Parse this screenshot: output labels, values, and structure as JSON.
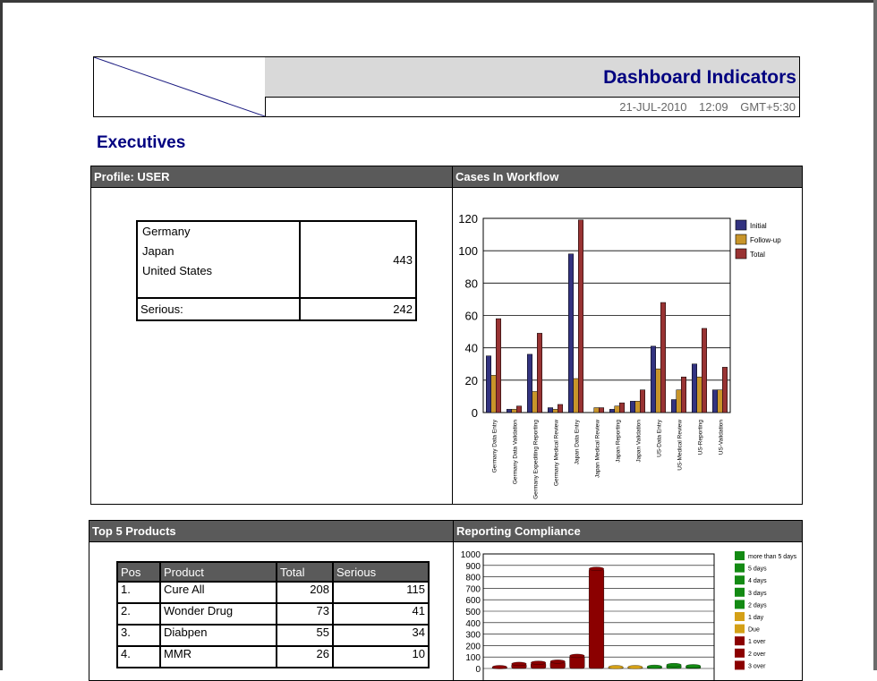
{
  "header": {
    "title": "Dashboard Indicators",
    "date": "21-JUL-2010",
    "time": "12:09",
    "timezone": "GMT+5:30"
  },
  "section_title": "Executives",
  "profile": {
    "heading": "Profile: USER",
    "countries": [
      "Germany",
      "Japan",
      "United States"
    ],
    "count": "443",
    "serious_label": "Serious:",
    "serious_value": "242"
  },
  "workflow": {
    "heading": "Cases In Workflow"
  },
  "products": {
    "heading": "Top 5  Products",
    "columns": [
      "Pos",
      "Product",
      "Total",
      "Serious"
    ],
    "rows": [
      [
        "1.",
        "Cure All",
        "208",
        "115"
      ],
      [
        "2.",
        "Wonder Drug",
        "73",
        "41"
      ],
      [
        "3.",
        "Diabpen",
        "55",
        "34"
      ],
      [
        "4.",
        "MMR",
        "26",
        "10"
      ]
    ]
  },
  "compliance": {
    "heading": "Reporting Compliance"
  },
  "colors": {
    "initial": "#333380",
    "followup": "#c8952a",
    "total": "#993333",
    "panel_header": "#5a5a5a",
    "title_blue": "#000080",
    "green": "#138a13",
    "gold": "#d4a017",
    "darkred": "#8b0000"
  },
  "chart_data": [
    {
      "type": "bar",
      "categories": [
        "Germany Data Entry",
        "Germany Data Validation",
        "Germany Expediting Reporting",
        "Germany Medical Review",
        "Japan Data Entry",
        "Japan Medical Review",
        "Japan Reporting",
        "Japan Validation",
        "US-Data Entry",
        "US-Medical Review",
        "US-Reporting",
        "US-Validation"
      ],
      "series": [
        {
          "name": "Initial",
          "values": [
            35,
            2,
            36,
            3,
            98,
            0,
            2,
            7,
            41,
            8,
            30,
            14
          ]
        },
        {
          "name": "Follow-up",
          "values": [
            23,
            2,
            13,
            2,
            21,
            3,
            4,
            7,
            27,
            14,
            22,
            14
          ]
        },
        {
          "name": "Total",
          "values": [
            58,
            4,
            49,
            5,
            119,
            3,
            6,
            14,
            68,
            22,
            52,
            28
          ]
        }
      ],
      "ylim": [
        0,
        120
      ],
      "yticks": [
        "0",
        "20",
        "40",
        "60",
        "80",
        "100",
        "120"
      ],
      "grid": true,
      "legend": "top-right"
    },
    {
      "type": "bar",
      "ylim": [
        0,
        1000
      ],
      "yticks": [
        "0",
        "100",
        "200",
        "300",
        "400",
        "500",
        "600",
        "700",
        "800",
        "900",
        "1000"
      ],
      "legend": "right",
      "legend_entries": [
        {
          "label": "more than 5 days",
          "color": "#138a13"
        },
        {
          "label": "5 days",
          "color": "#138a13"
        },
        {
          "label": "4 days",
          "color": "#138a13"
        },
        {
          "label": "3 days",
          "color": "#138a13"
        },
        {
          "label": "2 days",
          "color": "#138a13"
        },
        {
          "label": "1 day",
          "color": "#d4a017"
        },
        {
          "label": "Due",
          "color": "#d4a017"
        },
        {
          "label": "1 over",
          "color": "#8b0000"
        },
        {
          "label": "2 over",
          "color": "#8b0000"
        },
        {
          "label": "3 over",
          "color": "#8b0000"
        }
      ],
      "bars": [
        {
          "value": 0,
          "color": "#8b0000"
        },
        {
          "value": 40,
          "color": "#8b0000"
        },
        {
          "value": 50,
          "color": "#8b0000"
        },
        {
          "value": 60,
          "color": "#8b0000"
        },
        {
          "value": 110,
          "color": "#8b0000"
        },
        {
          "value": 870,
          "color": "#8b0000"
        },
        {
          "value": 0,
          "color": "#d4a017"
        },
        {
          "value": 10,
          "color": "#d4a017"
        },
        {
          "value": 15,
          "color": "#138a13"
        },
        {
          "value": 30,
          "color": "#138a13"
        },
        {
          "value": 20,
          "color": "#138a13"
        }
      ]
    }
  ]
}
